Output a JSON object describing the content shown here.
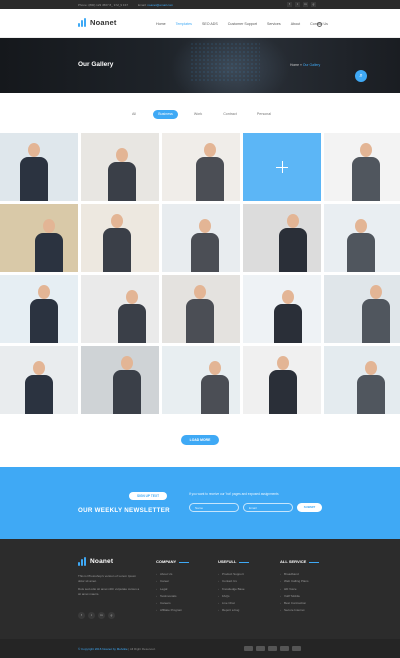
{
  "topbar": {
    "phone": "Phone: (800) 123 4567 8_ 9 M_9 F47",
    "email_label": "Email:",
    "email": "noanet@email.com",
    "social": [
      "f",
      "t",
      "in",
      "g"
    ]
  },
  "nav": {
    "logo": "Noanet",
    "items": [
      "Home",
      "Templates",
      "SEO ADS",
      "Customer Support",
      "Services",
      "About",
      "Contact Us"
    ],
    "active_index": 1
  },
  "hero": {
    "title": "Our Gallery",
    "breadcrumb_home": "Home",
    "breadcrumb_sep": "»",
    "breadcrumb_current": "Our Gallery"
  },
  "filters": [
    "All",
    "Business",
    "Work",
    "Contract",
    "Personal"
  ],
  "filters_active_index": 1,
  "gallery": {
    "rows": 4,
    "cols": 5,
    "hovered_index": 3
  },
  "load_more": "LOAD MORE",
  "newsletter": {
    "signup": "SIGN UP TEXT",
    "title": "OUR WEEKLY NEWSLETTER",
    "desc": "If you want to receive our 'hot' pages and exposed assignments",
    "name_placeholder": "Name",
    "email_placeholder": "Email",
    "submit": "SUBMIT"
  },
  "footer": {
    "logo": "Noanet",
    "about_1": "This is Photoshop's version of Lorem Ipsum dolor sit amet.",
    "about_2": "Duis sed odio sit amet nibh vulputate cursus a sit amet mauris.",
    "social": [
      "f",
      "t",
      "in",
      "g"
    ],
    "company": {
      "title": "COMPANY",
      "links": [
        "About Us",
        "Career",
        "Legal",
        "Testimonials",
        "Careers",
        "Affiliate Program"
      ]
    },
    "usefull": {
      "title": "USEFULL",
      "links": [
        "Product Support",
        "Contact Us",
        "Knowledge Base",
        "FAQs",
        "Live Chat",
        "Report a bug"
      ]
    },
    "all_service": {
      "title": "ALL SERVICE",
      "links": [
        "Broadband",
        "Web Calling Plans",
        "HD Voice",
        "VoIP Mobile",
        "Best Contraction",
        "Secure Internet"
      ]
    }
  },
  "bottom": {
    "copyright": "© Copyright 2016 Noanet by Melvikie",
    "copyright_rest": "  |  All Right Reserved.",
    "payments": [
      "visa",
      "mastercard",
      "amex",
      "paypal",
      "discover"
    ]
  },
  "colors": {
    "accent": "#3fa9f5",
    "dark": "#2c2c2c",
    "hero": "#1e2329"
  }
}
